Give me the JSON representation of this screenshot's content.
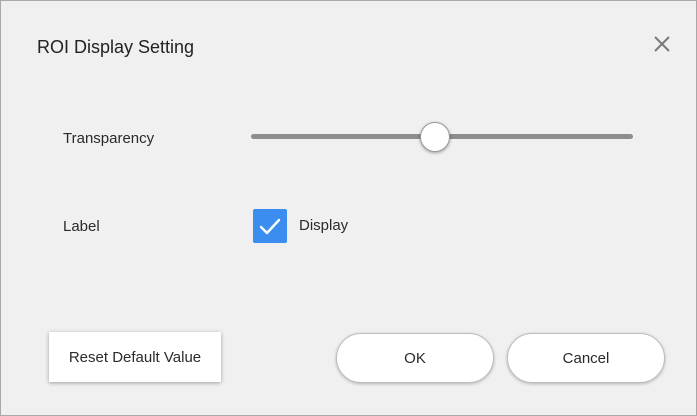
{
  "dialog": {
    "title": "ROI Display Setting",
    "close_icon": "close-icon"
  },
  "transparency": {
    "label": "Transparency",
    "value_fraction": 0.48
  },
  "label_setting": {
    "label": "Label",
    "checkbox_text": "Display",
    "checked": true,
    "check_icon": "checkmark-icon"
  },
  "buttons": {
    "reset_label": "Reset Default Value",
    "ok_label": "OK",
    "cancel_label": "Cancel"
  },
  "colors": {
    "accent": "#3c8df0",
    "background": "#f0f0f0",
    "track": "#8d8d8d"
  }
}
